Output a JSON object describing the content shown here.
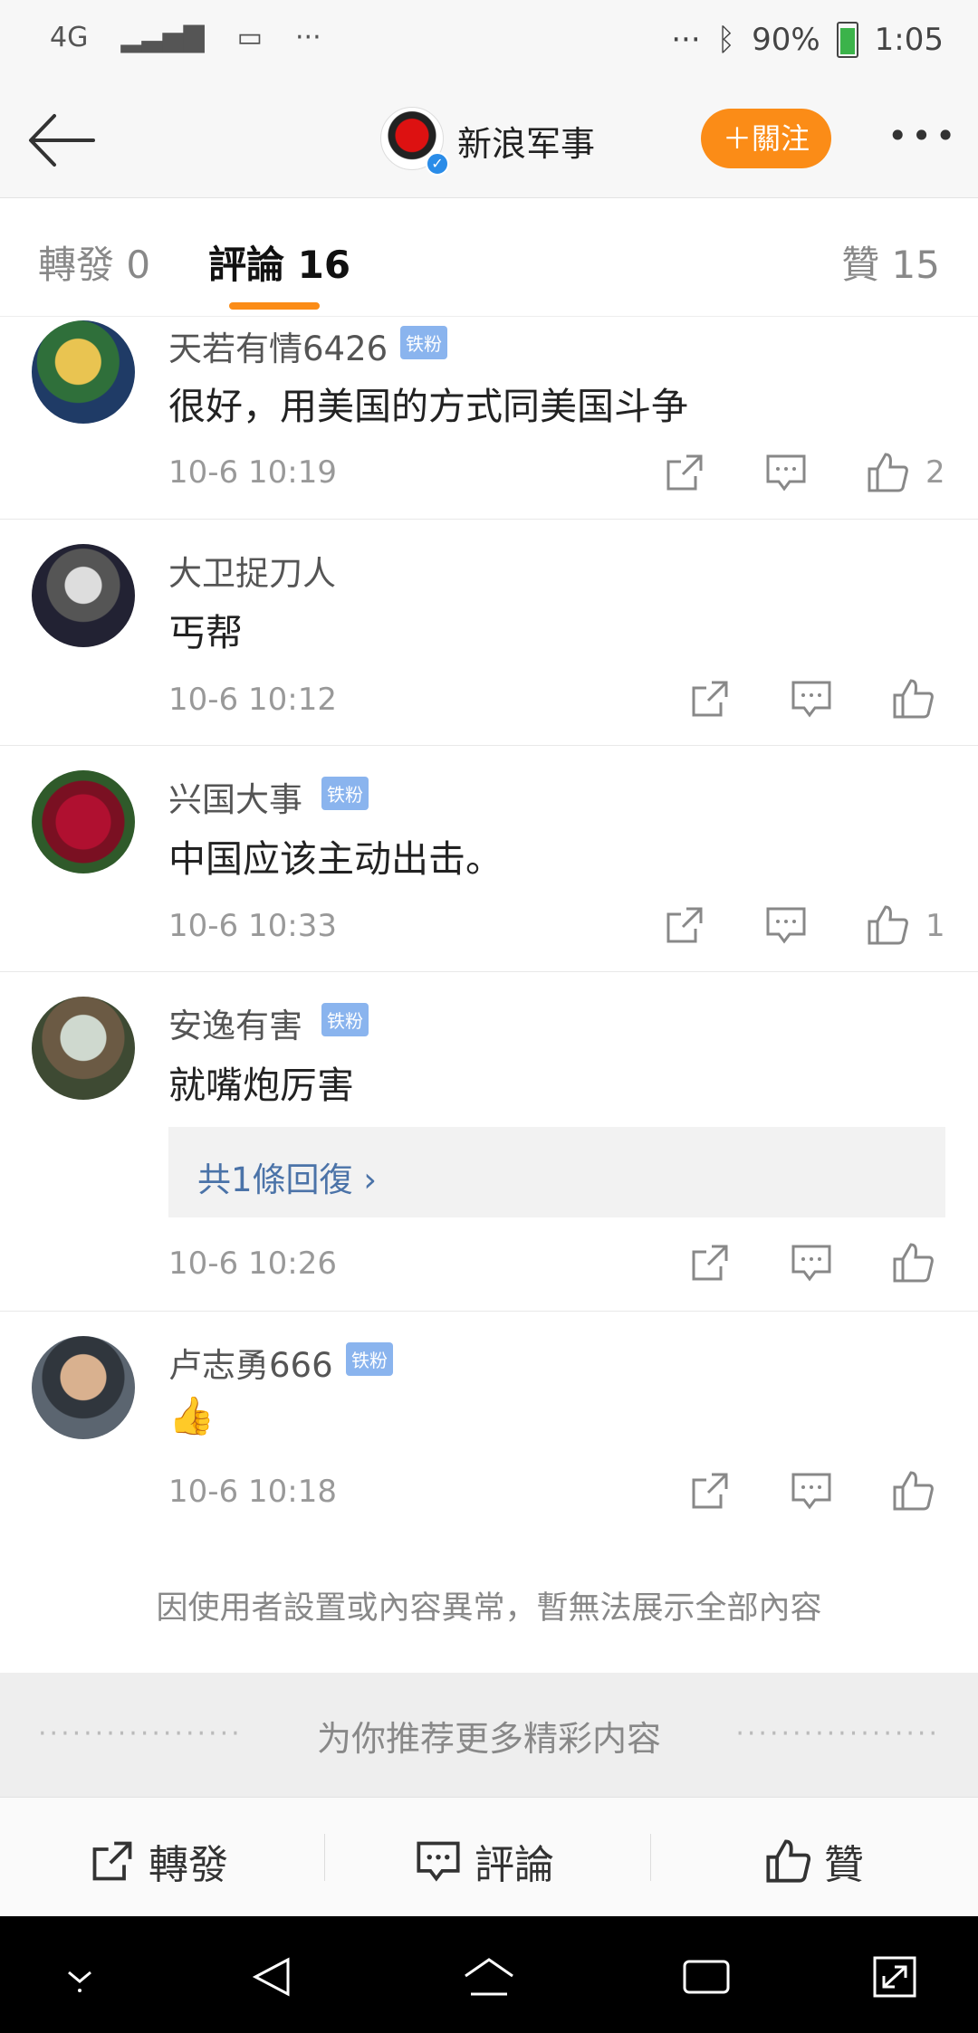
{
  "status_bar": {
    "network": "4G",
    "battery": "90%",
    "time": "1:05"
  },
  "header": {
    "account_name": "新浪军事",
    "follow_label": "＋關注"
  },
  "tabs": {
    "repost": "轉發 0",
    "comments": "評論 16",
    "likes": "贊 15"
  },
  "comments": [
    {
      "name": "天若有情6426",
      "badge": "铁粉",
      "text": "很好，用美国的方式同美国斗争",
      "time": "10-6 10:19",
      "likes": "2"
    },
    {
      "name": "大卫捉刀人",
      "badge": "",
      "text": "丐帮",
      "time": "10-6 10:12",
      "likes": ""
    },
    {
      "name": "兴国大事",
      "badge": "铁粉",
      "text": "中国应该主动出击。",
      "time": "10-6 10:33",
      "likes": "1"
    },
    {
      "name": "安逸有害",
      "badge": "铁粉",
      "text": "就嘴炮厉害",
      "time": "10-6 10:26",
      "likes": "",
      "reply_label": "共1條回復 ›"
    },
    {
      "name": "卢志勇666",
      "badge": "铁粉",
      "text": "👍",
      "time": "10-6 10:18",
      "likes": ""
    }
  ],
  "notice": "因使用者設置或內容異常，暫無法展示全部內容",
  "recommend": "为你推荐更多精彩内容",
  "bottom_bar": {
    "repost": "轉發",
    "comment": "評論",
    "like": "贊"
  },
  "colors": {
    "accent": "#fb8c17",
    "badge": "#8ab4ee",
    "link": "#4b73a8"
  }
}
